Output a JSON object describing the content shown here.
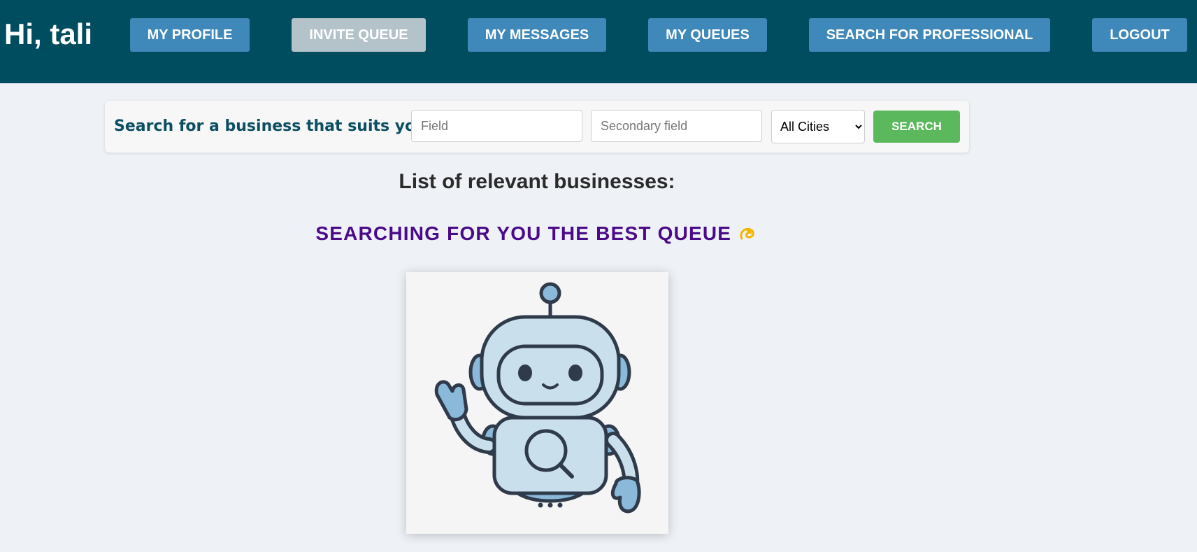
{
  "header": {
    "greeting": "Hi, tali",
    "nav": {
      "my_profile": "MY PROFILE",
      "invite_queue": "INVITE QUEUE",
      "my_messages": "MY MESSAGES",
      "my_queues": "MY QUEUES",
      "search_professional": "SEARCH FOR PROFESSIONAL",
      "logout": "LOGOUT"
    },
    "colors": {
      "background": "#004d60",
      "button": "#3f88ba",
      "button_disabled": "#b4c2ca"
    }
  },
  "search": {
    "label": "Search for a business that suits you:",
    "field_placeholder": "Field",
    "field_value": "",
    "secondary_placeholder": "Secondary field",
    "secondary_value": "",
    "city_selected": "All Cities",
    "button_label": "SEARCH",
    "button_color": "#5cb85c"
  },
  "main": {
    "list_title": "List of relevant businesses:",
    "searching_text": "SEARCHING FOR YOU THE BEST QUEUE",
    "searching_icon": "dizzy-icon",
    "image": "robot-with-magnifier-icon"
  }
}
